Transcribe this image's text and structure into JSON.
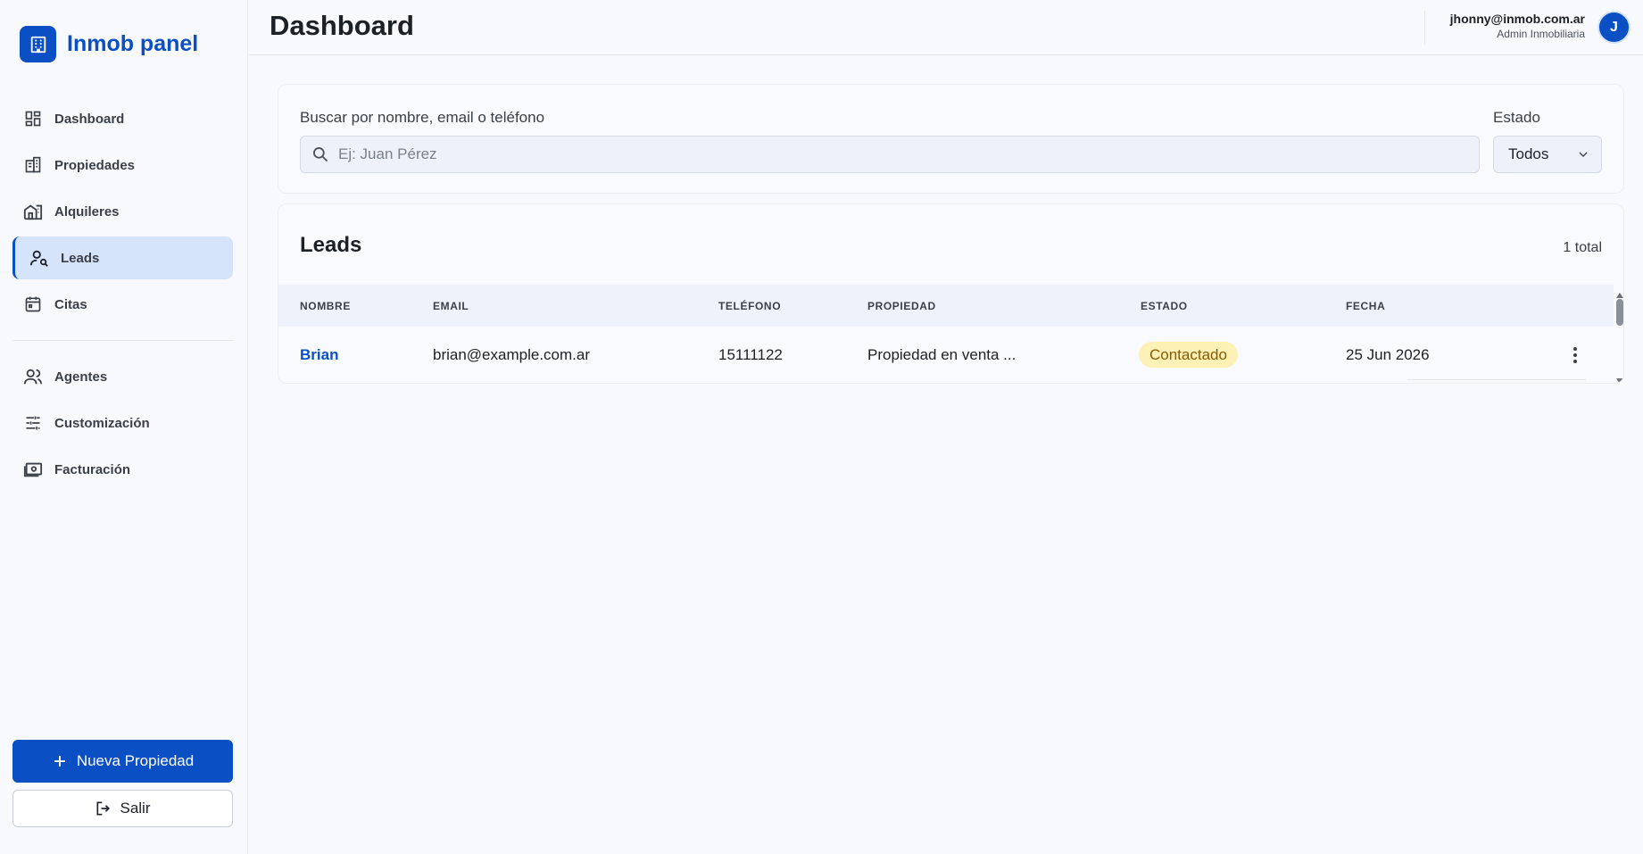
{
  "brand": {
    "name": "Inmob panel",
    "icon": "building-icon"
  },
  "nav": {
    "items": [
      {
        "label": "Dashboard",
        "icon": "dashboard-icon"
      },
      {
        "label": "Propiedades",
        "icon": "buildings-icon"
      },
      {
        "label": "Alquileres",
        "icon": "rental-house-icon"
      },
      {
        "label": "Leads",
        "icon": "person-search-icon",
        "active": true
      },
      {
        "label": "Citas",
        "icon": "calendar-icon"
      },
      {
        "label": "Agentes",
        "icon": "users-icon"
      },
      {
        "label": "Customización",
        "icon": "sliders-icon"
      },
      {
        "label": "Facturación",
        "icon": "billing-icon"
      }
    ]
  },
  "actions": {
    "new_property": "Nueva Propiedad",
    "logout": "Salir"
  },
  "header": {
    "title": "Dashboard",
    "user_email": "jhonny@inmob.com.ar",
    "user_role": "Admin Inmobiliaria",
    "avatar_initial": "J"
  },
  "filters": {
    "search_label": "Buscar por nombre, email o teléfono",
    "search_placeholder": "Ej: Juan Pérez",
    "search_value": "",
    "status_label": "Estado",
    "status_value": "Todos"
  },
  "leads": {
    "title": "Leads",
    "total": "1 total",
    "columns": [
      "NOMBRE",
      "EMAIL",
      "TELÉFONO",
      "PROPIEDAD",
      "ESTADO",
      "FECHA"
    ],
    "rows": [
      {
        "nombre": "Brian",
        "email": "brian@example.com.ar",
        "telefono": "15111122",
        "propiedad": "Propiedad en venta ...",
        "estado": "Contactado",
        "fecha": "25 Jun 2026"
      }
    ]
  },
  "colors": {
    "primary": "#0b4fc4",
    "active_nav_bg": "#d6e4fb",
    "badge_bg": "#fdf1b6",
    "badge_text": "#8a5a00"
  }
}
